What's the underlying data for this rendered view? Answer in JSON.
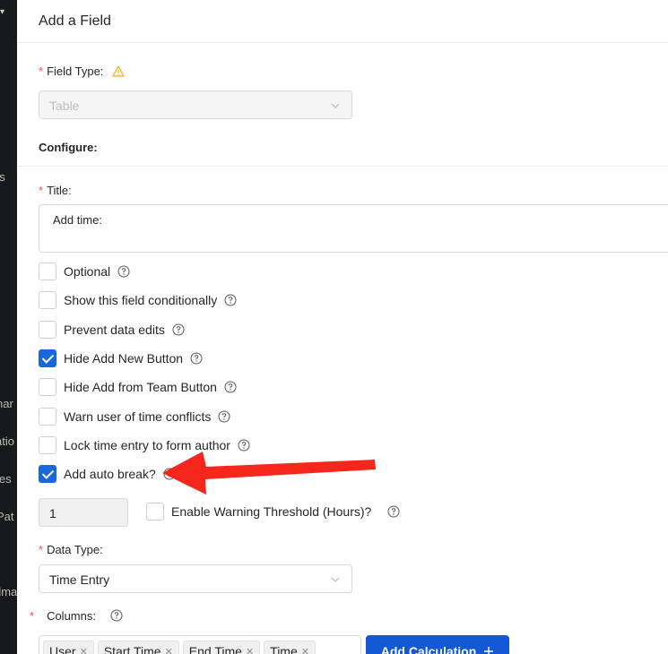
{
  "background_app": {
    "fragments": [
      "ds",
      "s",
      "nar",
      "atio",
      "les",
      "Pat",
      "dma"
    ]
  },
  "drawer": {
    "title": "Add a Field"
  },
  "field_type": {
    "label": "Field Type:",
    "value": "Table",
    "warning_icon": "warning-triangle-icon"
  },
  "configure": {
    "heading": "Configure:"
  },
  "title_field": {
    "label": "Title:",
    "value": "Add time:"
  },
  "options": [
    {
      "label": "Optional",
      "checked": false
    },
    {
      "label": "Show this field conditionally",
      "checked": false
    },
    {
      "label": "Prevent data edits",
      "checked": false
    },
    {
      "label": "Hide Add New Button",
      "checked": true
    },
    {
      "label": "Hide Add from Team Button",
      "checked": false
    },
    {
      "label": "Warn user of time conflicts",
      "checked": false
    },
    {
      "label": "Lock time entry to form author",
      "checked": false
    },
    {
      "label": "Add auto break?",
      "checked": true
    }
  ],
  "auto_break": {
    "value": "1",
    "threshold_label": "Enable Warning Threshold (Hours)?",
    "threshold_checked": false
  },
  "data_type": {
    "label": "Data Type:",
    "value": "Time Entry"
  },
  "columns": {
    "label": "Columns:",
    "tags": [
      "User",
      "Start Time",
      "End Time",
      "Time"
    ],
    "add_calculation_label": "Add Calculation",
    "add_icon": "plus-icon"
  },
  "annotation": {
    "arrow_color": "#f5261b",
    "points_to": "Add auto break?"
  },
  "colors": {
    "primary": "#1558d6",
    "checkbox_checked": "#1668dc",
    "required": "#ff4d4f",
    "warning": "#faad14"
  }
}
